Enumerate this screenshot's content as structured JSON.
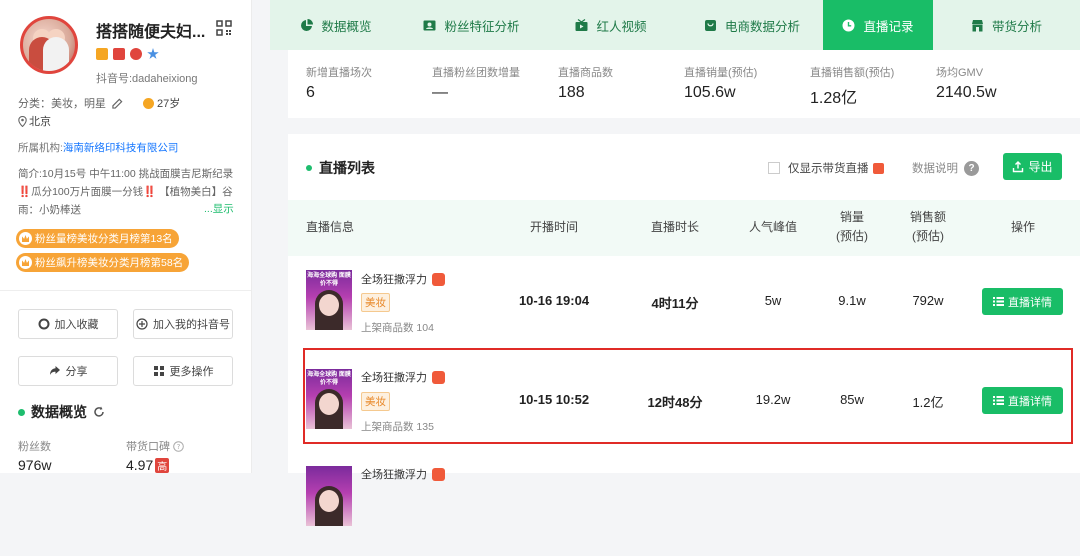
{
  "profile": {
    "name": "搭搭随便夫妇...",
    "douyin_id": "抖音号:dadaheixiong",
    "category_label": "分类：美妆，明星",
    "age": "27岁",
    "location": "北京",
    "org_label": "所属机构:",
    "org_name": "海南新络印科技有限公司",
    "intro": "简介:10月15号 中午11:00 挑战面膜吉尼斯纪录 ‼️瓜分100万片面膜一分钱‼️ 【植物美白】谷雨：小奶棒送",
    "more": "...显示",
    "rank_tags": [
      "粉丝量榜美妆分类月榜第13名",
      "粉丝飙升榜美妆分类月榜第58名"
    ],
    "buttons": {
      "favorite": "加入收藏",
      "add_my_douyin": "加入我的抖音号",
      "share": "分享",
      "more_actions": "更多操作"
    },
    "overview_title": "数据概览",
    "fans_label": "粉丝数",
    "fans_value": "976w",
    "reputation_label": "带货口碑",
    "reputation_value": "4.97",
    "reputation_badge": "高"
  },
  "tabs": [
    {
      "label": "数据概览",
      "icon": "pie-chart-icon",
      "active": false
    },
    {
      "label": "粉丝特征分析",
      "icon": "id-card-icon",
      "active": false
    },
    {
      "label": "红人视频",
      "icon": "video-icon",
      "active": false
    },
    {
      "label": "电商数据分析",
      "icon": "shopping-bag-icon",
      "active": false
    },
    {
      "label": "直播记录",
      "icon": "clock-icon",
      "active": true
    },
    {
      "label": "带货分析",
      "icon": "store-icon",
      "active": false
    }
  ],
  "summary": [
    {
      "label": "新增直播场次",
      "value": "6"
    },
    {
      "label": "直播粉丝团数增量",
      "value": "—"
    },
    {
      "label": "直播商品数",
      "value": "188"
    },
    {
      "label": "直播销量(预估)",
      "value": "105.6w"
    },
    {
      "label": "直播销售额(预估)",
      "value": "1.28亿"
    },
    {
      "label": "场均GMV",
      "value": "2140.5w"
    }
  ],
  "live_list": {
    "title": "直播列表",
    "only_goods_label": "仅显示带货直播",
    "data_desc_label": "数据说明",
    "export_label": "导出",
    "headers": {
      "info": "直播信息",
      "start_time": "开播时间",
      "duration": "直播时长",
      "peak": "人气峰值",
      "sales_line1": "销量",
      "sales_line2": "(预估)",
      "revenue_line1": "销售额",
      "revenue_line2": "(预估)",
      "actions": "操作"
    },
    "thumb_text": "海海全球购 面膜价不得",
    "rows": [
      {
        "title": "全场狂撒浮力",
        "category": "美妆",
        "goods": "上架商品数 104",
        "start_time": "10-16 19:04",
        "duration": "4时11分",
        "peak": "5w",
        "sales": "9.1w",
        "revenue": "792w",
        "action": "直播详情"
      },
      {
        "title": "全场狂撒浮力",
        "category": "美妆",
        "goods": "上架商品数 135",
        "start_time": "10-15 10:52",
        "duration": "12时48分",
        "peak": "19.2w",
        "sales": "85w",
        "revenue": "1.2亿",
        "action": "直播详情"
      },
      {
        "title": "全场狂撒浮力"
      }
    ]
  }
}
